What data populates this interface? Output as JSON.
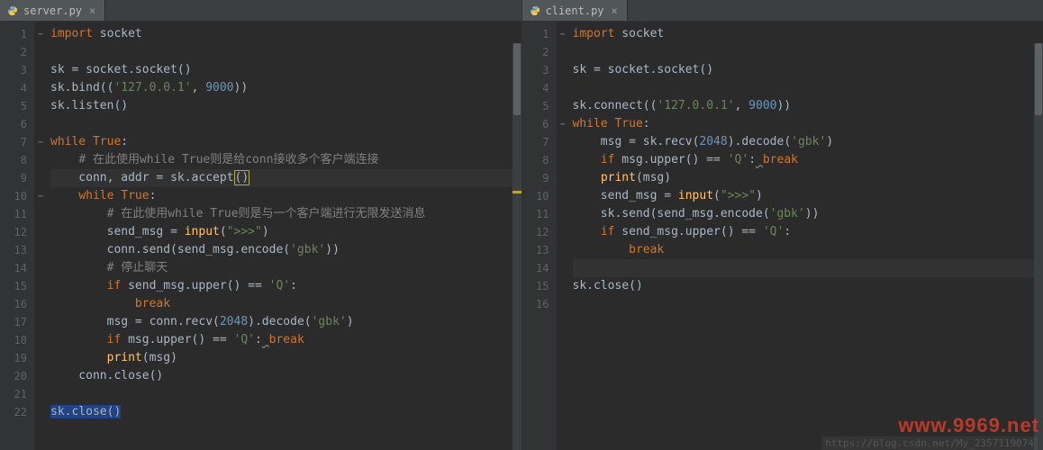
{
  "panes": [
    {
      "tab": {
        "filename": "server.py",
        "close": "×"
      },
      "lines": [
        1,
        2,
        3,
        4,
        5,
        6,
        7,
        8,
        9,
        10,
        11,
        12,
        13,
        14,
        15,
        16,
        17,
        18,
        19,
        20,
        21,
        22
      ],
      "folds": {
        "0": "−",
        "6": "−",
        "9": "−"
      },
      "code_tokens": [
        [
          {
            "t": "import",
            "c": "kw"
          },
          {
            "t": " socket"
          }
        ],
        [],
        [
          {
            "t": "sk "
          },
          {
            "t": "=",
            "c": "op"
          },
          {
            "t": " socket.socket()"
          }
        ],
        [
          {
            "t": "sk.bind(("
          },
          {
            "t": "'127.0.0.1'",
            "c": "str"
          },
          {
            "t": ", ",
            "c": "op"
          },
          {
            "t": "9000",
            "c": "num"
          },
          {
            "t": "))"
          }
        ],
        [
          {
            "t": "sk.listen()"
          }
        ],
        [],
        [
          {
            "t": "while ",
            "c": "kw"
          },
          {
            "t": "True",
            "c": "kw"
          },
          {
            "t": ":"
          }
        ],
        [
          {
            "t": "    "
          },
          {
            "t": "# 在此使用while True则是给conn接收多个客户端连接",
            "c": "cmt"
          }
        ],
        [
          {
            "t": "    conn"
          },
          {
            "t": ", ",
            "c": "op"
          },
          {
            "t": "addr "
          },
          {
            "t": "=",
            "c": "op"
          },
          {
            "t": " sk.accept"
          },
          {
            "t": "()",
            "caret": true
          }
        ],
        [
          {
            "t": "    "
          },
          {
            "t": "while ",
            "c": "kw"
          },
          {
            "t": "True",
            "c": "kw"
          },
          {
            "t": ":"
          }
        ],
        [
          {
            "t": "        "
          },
          {
            "t": "# 在此使用while True则是与一个客户端进行无限发送消息",
            "c": "cmt"
          }
        ],
        [
          {
            "t": "        send_msg "
          },
          {
            "t": "=",
            "c": "op"
          },
          {
            "t": " "
          },
          {
            "t": "input",
            "c": "fn"
          },
          {
            "t": "("
          },
          {
            "t": "\">>>\"",
            "c": "str"
          },
          {
            "t": ")"
          }
        ],
        [
          {
            "t": "        conn.send(send_msg.encode("
          },
          {
            "t": "'gbk'",
            "c": "str"
          },
          {
            "t": "))"
          }
        ],
        [
          {
            "t": "        "
          },
          {
            "t": "# 停止聊天",
            "c": "cmt"
          }
        ],
        [
          {
            "t": "        "
          },
          {
            "t": "if ",
            "c": "kw"
          },
          {
            "t": "send_msg.upper() "
          },
          {
            "t": "==",
            "c": "op"
          },
          {
            "t": " "
          },
          {
            "t": "'Q'",
            "c": "str"
          },
          {
            "t": ":"
          }
        ],
        [
          {
            "t": "            "
          },
          {
            "t": "break",
            "c": "kw"
          }
        ],
        [
          {
            "t": "        msg "
          },
          {
            "t": "=",
            "c": "op"
          },
          {
            "t": " conn.recv("
          },
          {
            "t": "2048",
            "c": "num"
          },
          {
            "t": ").decode("
          },
          {
            "t": "'gbk'",
            "c": "str"
          },
          {
            "t": ")"
          }
        ],
        [
          {
            "t": "        "
          },
          {
            "t": "if ",
            "c": "kw"
          },
          {
            "t": "msg.upper() "
          },
          {
            "t": "==",
            "c": "op"
          },
          {
            "t": " "
          },
          {
            "t": "'Q'",
            "c": "str"
          },
          {
            "t": ":"
          },
          {
            "t": " ",
            "u": true
          },
          {
            "t": "break",
            "c": "kw"
          }
        ],
        [
          {
            "t": "        "
          },
          {
            "t": "print",
            "c": "fn"
          },
          {
            "t": "(msg)"
          }
        ],
        [
          {
            "t": "    conn.close()"
          }
        ],
        [],
        [
          {
            "t": "sk.close()",
            "sel": true
          }
        ]
      ],
      "highlight_line": 8,
      "marker_line": 8
    },
    {
      "tab": {
        "filename": "client.py",
        "close": "×"
      },
      "lines": [
        1,
        2,
        3,
        4,
        5,
        6,
        7,
        8,
        9,
        10,
        11,
        12,
        13,
        14,
        15,
        16
      ],
      "folds": {
        "0": "−",
        "5": "−"
      },
      "code_tokens": [
        [
          {
            "t": "import",
            "c": "kw"
          },
          {
            "t": " socket"
          }
        ],
        [],
        [
          {
            "t": "sk "
          },
          {
            "t": "=",
            "c": "op"
          },
          {
            "t": " socket.socket()"
          }
        ],
        [],
        [
          {
            "t": "sk.connect(("
          },
          {
            "t": "'127.0.0.1'",
            "c": "str"
          },
          {
            "t": ", ",
            "c": "op"
          },
          {
            "t": "9000",
            "c": "num"
          },
          {
            "t": "))"
          }
        ],
        [
          {
            "t": "while ",
            "c": "kw"
          },
          {
            "t": "True",
            "c": "kw"
          },
          {
            "t": ":"
          }
        ],
        [
          {
            "t": "    msg "
          },
          {
            "t": "=",
            "c": "op"
          },
          {
            "t": " sk.recv("
          },
          {
            "t": "2048",
            "c": "num"
          },
          {
            "t": ").decode("
          },
          {
            "t": "'gbk'",
            "c": "str"
          },
          {
            "t": ")"
          }
        ],
        [
          {
            "t": "    "
          },
          {
            "t": "if ",
            "c": "kw"
          },
          {
            "t": "msg.upper() "
          },
          {
            "t": "==",
            "c": "op"
          },
          {
            "t": " "
          },
          {
            "t": "'Q'",
            "c": "str"
          },
          {
            "t": ":"
          },
          {
            "t": " ",
            "u": true
          },
          {
            "t": "break",
            "c": "kw"
          }
        ],
        [
          {
            "t": "    "
          },
          {
            "t": "print",
            "c": "fn"
          },
          {
            "t": "(msg)"
          }
        ],
        [
          {
            "t": "    send_msg "
          },
          {
            "t": "=",
            "c": "op"
          },
          {
            "t": " "
          },
          {
            "t": "input",
            "c": "fn"
          },
          {
            "t": "("
          },
          {
            "t": "\">>>\"",
            "c": "str"
          },
          {
            "t": ")"
          }
        ],
        [
          {
            "t": "    sk.send(send_msg.encode("
          },
          {
            "t": "'gbk'",
            "c": "str"
          },
          {
            "t": "))"
          }
        ],
        [
          {
            "t": "    "
          },
          {
            "t": "if ",
            "c": "kw"
          },
          {
            "t": "send_msg.upper() "
          },
          {
            "t": "==",
            "c": "op"
          },
          {
            "t": " "
          },
          {
            "t": "'Q'",
            "c": "str"
          },
          {
            "t": ":"
          }
        ],
        [
          {
            "t": "        "
          },
          {
            "t": "break",
            "c": "kw"
          }
        ],
        [],
        [
          {
            "t": "sk.close()"
          }
        ],
        []
      ],
      "highlight_line": 13
    }
  ],
  "status": "https://blog.csdn.net/My_2357119074",
  "watermark": "www.9969.net"
}
